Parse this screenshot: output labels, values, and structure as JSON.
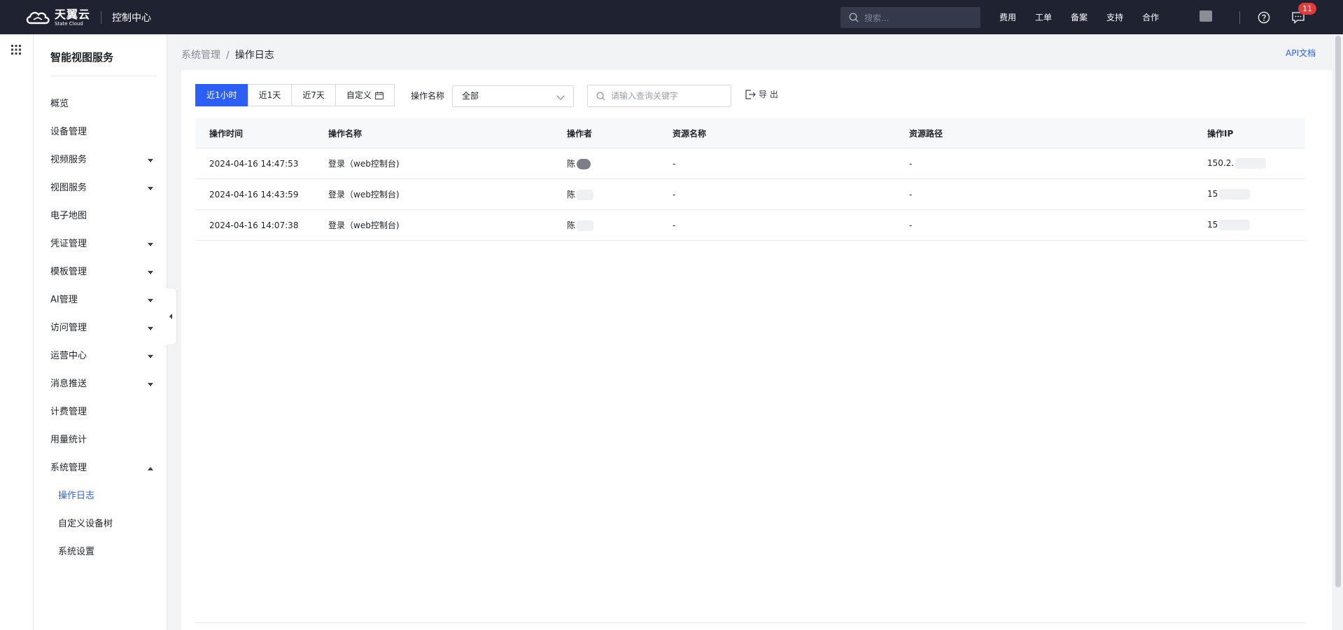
{
  "topbar": {
    "logo_cn": "天翼云",
    "logo_en": "State Cloud",
    "console_title": "控制中心",
    "search_placeholder": "搜索...",
    "links": [
      "费用",
      "工单",
      "备案",
      "支持",
      "合作"
    ],
    "notification_count": "11"
  },
  "sidebar": {
    "title": "智能视图服务",
    "items": [
      {
        "label": "概览",
        "expandable": false
      },
      {
        "label": "设备管理",
        "expandable": false
      },
      {
        "label": "视频服务",
        "expandable": true
      },
      {
        "label": "视图服务",
        "expandable": true
      },
      {
        "label": "电子地图",
        "expandable": false
      },
      {
        "label": "凭证管理",
        "expandable": true
      },
      {
        "label": "模板管理",
        "expandable": true
      },
      {
        "label": "AI管理",
        "expandable": true
      },
      {
        "label": "访问管理",
        "expandable": true
      },
      {
        "label": "运营中心",
        "expandable": true
      },
      {
        "label": "消息推送",
        "expandable": true
      },
      {
        "label": "计费管理",
        "expandable": false
      },
      {
        "label": "用量统计",
        "expandable": false
      },
      {
        "label": "系统管理",
        "expandable": true,
        "expanded": true
      }
    ],
    "sub_items": [
      {
        "label": "操作日志",
        "active": true
      },
      {
        "label": "自定义设备树"
      },
      {
        "label": "系统设置"
      }
    ]
  },
  "breadcrumb": {
    "parent": "系统管理",
    "separator": "/",
    "current": "操作日志"
  },
  "api_doc_link": "API文档",
  "filters": {
    "time_ranges": [
      "近1小时",
      "近1天",
      "近7天",
      "自定义"
    ],
    "active_time_range": "近1小时",
    "operation_label": "操作名称",
    "operation_value": "全部",
    "keyword_placeholder": "请输入查询关键字",
    "export_label": "导 出"
  },
  "table": {
    "columns": [
      "操作时间",
      "操作名称",
      "操作者",
      "资源名称",
      "资源路径",
      "操作IP"
    ],
    "rows": [
      {
        "time": "2024-04-16 14:47:53",
        "operation": "登录（web控制台)",
        "operator": "陈",
        "resource_name": "-",
        "resource_path": "-",
        "ip": "150.2."
      },
      {
        "time": "2024-04-16 14:43:59",
        "operation": "登录（web控制台)",
        "operator": "陈",
        "resource_name": "-",
        "resource_path": "-",
        "ip": "15"
      },
      {
        "time": "2024-04-16 14:07:38",
        "operation": "登录（web控制台)",
        "operator": "陈",
        "resource_name": "-",
        "resource_path": "-",
        "ip": "15"
      }
    ]
  },
  "colors": {
    "topbar_bg": "#1f2231",
    "accent": "#2b5ff5",
    "badge": "#e23b3b"
  }
}
